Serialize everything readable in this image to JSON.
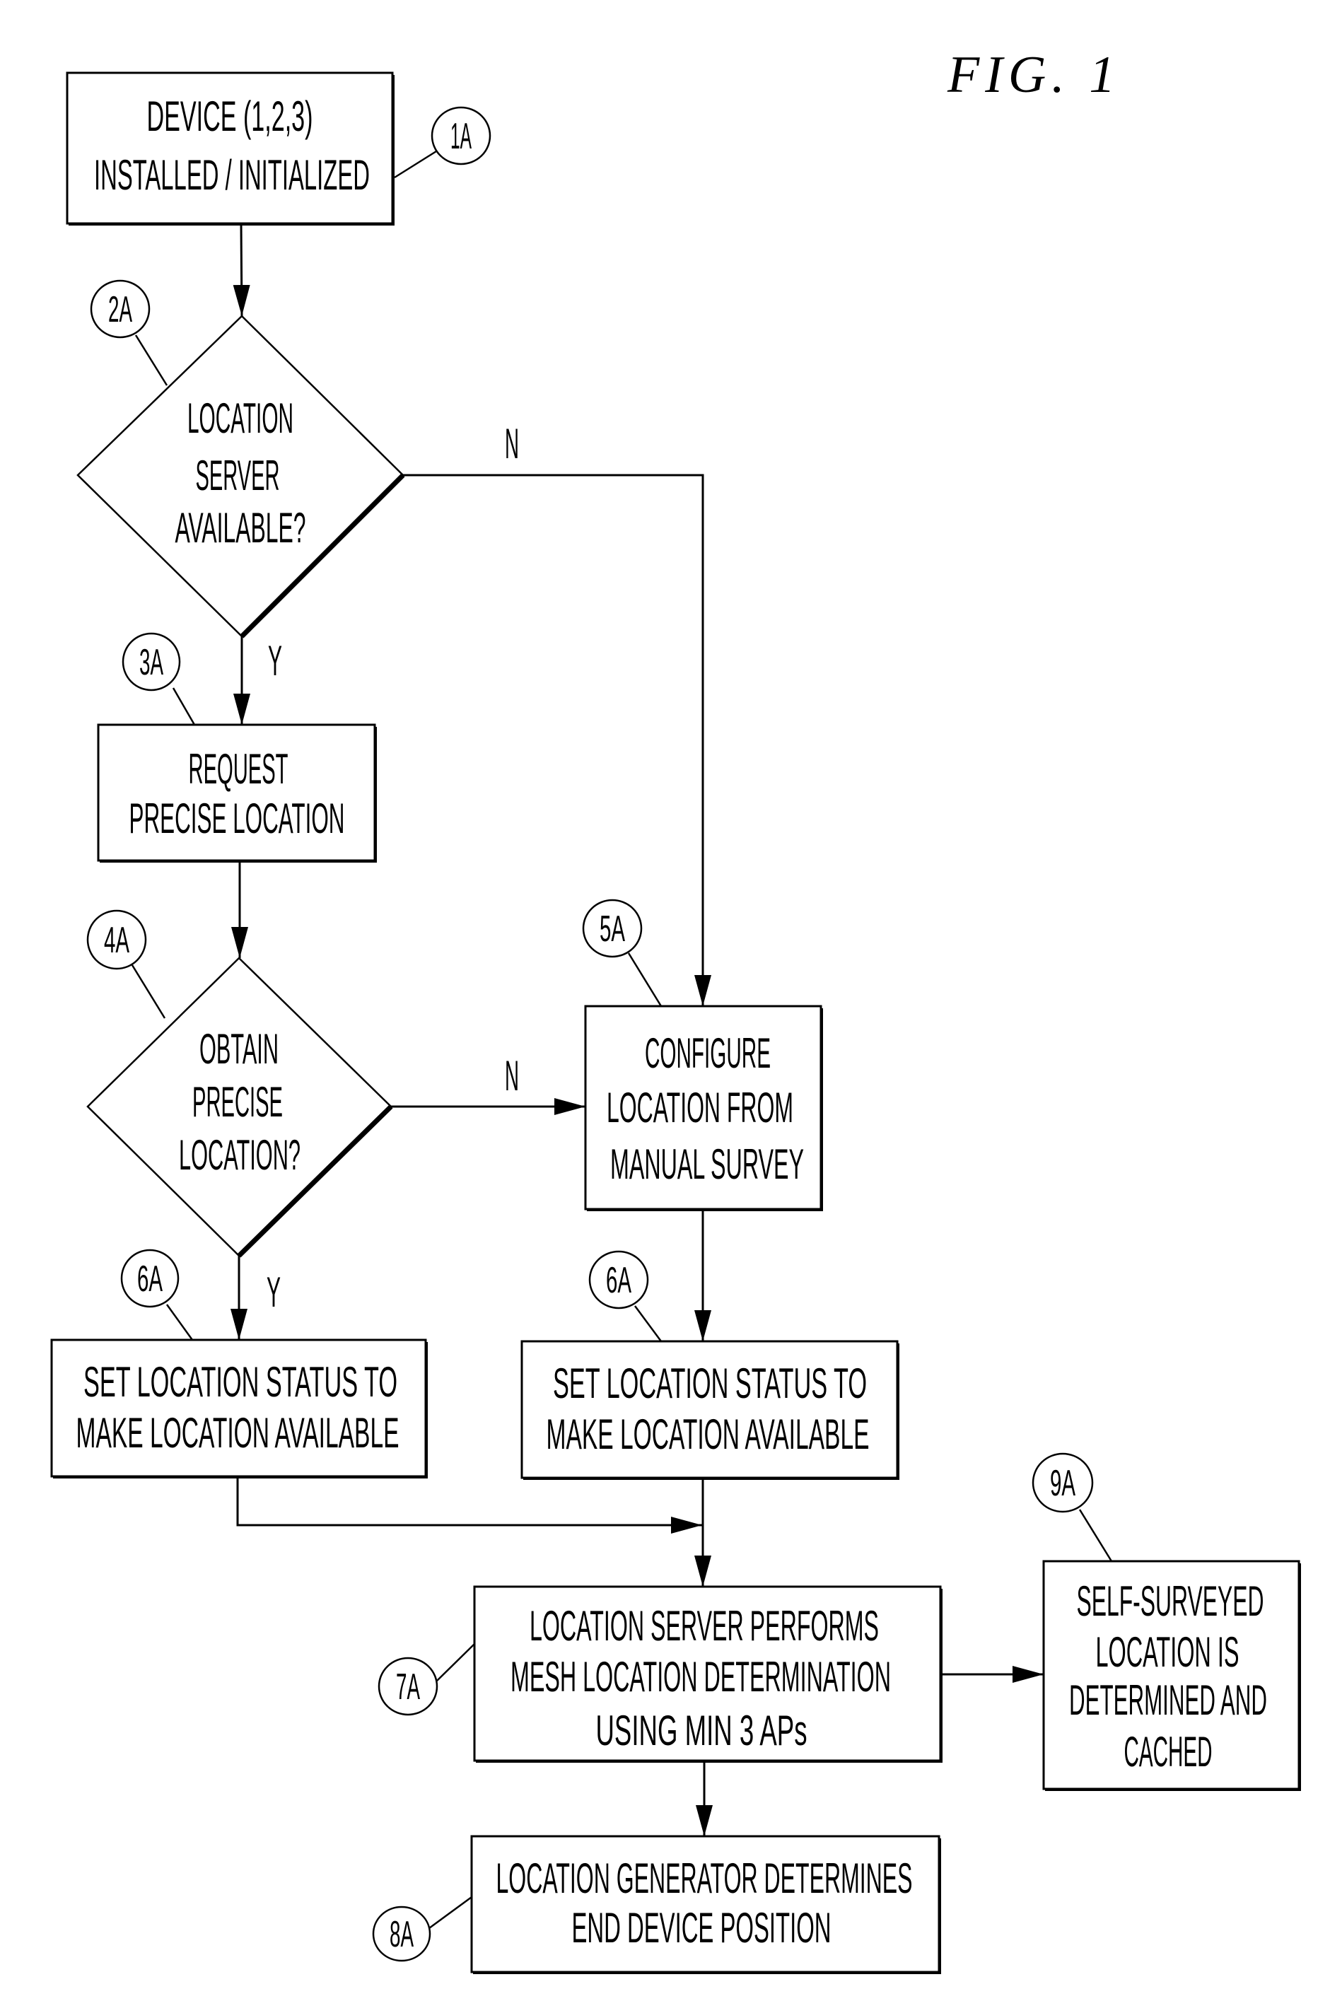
{
  "figure": {
    "title": "FIG.  1"
  },
  "nodes": {
    "n1": {
      "ref": "1A",
      "lines": [
        "DEVICE (1,2,3)",
        "INSTALLED / INITIALIZED"
      ]
    },
    "n2": {
      "ref": "2A",
      "lines": [
        "LOCATION",
        "SERVER",
        "AVAILABLE?"
      ]
    },
    "n3": {
      "ref": "3A",
      "lines": [
        "REQUEST",
        "PRECISE LOCATION"
      ]
    },
    "n4": {
      "ref": "4A",
      "lines": [
        "OBTAIN",
        "PRECISE",
        "LOCATION?"
      ]
    },
    "n5": {
      "ref": "5A",
      "lines": [
        "CONFIGURE",
        "LOCATION FROM",
        "MANUAL SURVEY"
      ]
    },
    "n6a": {
      "ref": "6A",
      "lines": [
        "SET LOCATION STATUS TO",
        "MAKE LOCATION AVAILABLE"
      ]
    },
    "n6b": {
      "ref": "6A",
      "lines": [
        "SET LOCATION STATUS TO",
        "MAKE LOCATION AVAILABLE"
      ]
    },
    "n7": {
      "ref": "7A",
      "lines": [
        "LOCATION SERVER PERFORMS",
        "MESH LOCATION DETERMINATION",
        "USING MIN 3 APs"
      ]
    },
    "n8": {
      "ref": "8A",
      "lines": [
        "LOCATION GENERATOR DETERMINES",
        "END DEVICE POSITION"
      ]
    },
    "n9": {
      "ref": "9A",
      "lines": [
        "SELF-SURVEYED",
        "LOCATION IS",
        "DETERMINED AND",
        "CACHED"
      ]
    }
  },
  "branches": {
    "d2_no": "N",
    "d2_yes": "Y",
    "d4_no": "N",
    "d4_yes": "Y"
  }
}
